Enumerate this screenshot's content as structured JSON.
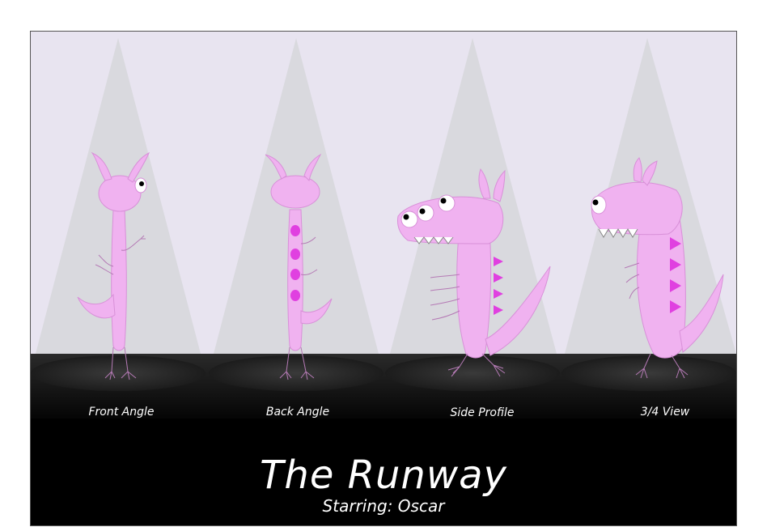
{
  "colors": {
    "backdrop": "#e8e4f0",
    "spotlight": "#d9d9de",
    "floor": "#111111",
    "monster_body": "#f0b2f0",
    "monster_spots": "#e040e0",
    "text": "#ffffff"
  },
  "views": [
    {
      "label": "Front Angle"
    },
    {
      "label": "Back Angle"
    },
    {
      "label": "Side Profile"
    },
    {
      "label": "3/4 View"
    }
  ],
  "title": "The Runway",
  "subtitle": "Starring: Oscar"
}
